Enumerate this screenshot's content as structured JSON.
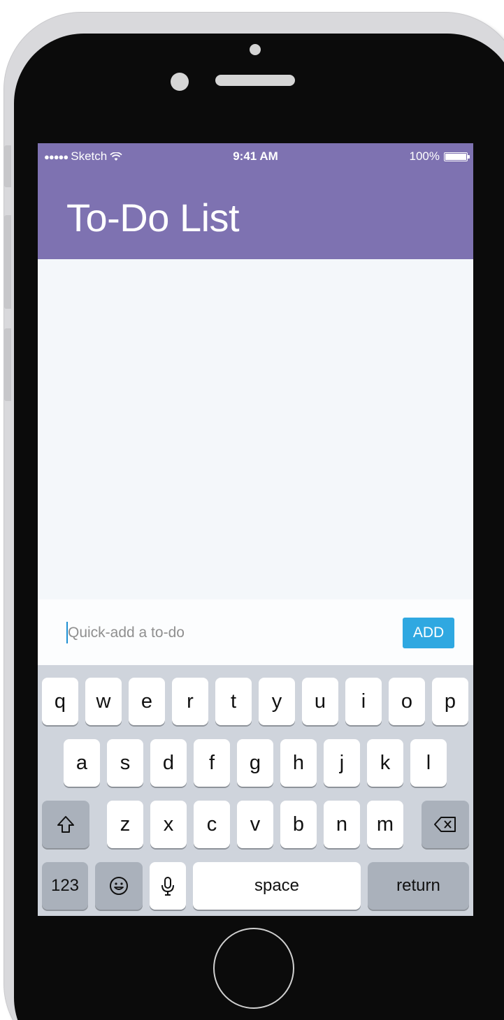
{
  "status_bar": {
    "carrier": "Sketch",
    "time": "9:41 AM",
    "battery": "100%"
  },
  "header": {
    "title": "To-Do List"
  },
  "todos": [],
  "quick_add": {
    "placeholder": "Quick-add a to-do",
    "value": "",
    "add_label": "ADD"
  },
  "keyboard": {
    "row1": [
      "q",
      "w",
      "e",
      "r",
      "t",
      "y",
      "u",
      "i",
      "o",
      "p"
    ],
    "row2": [
      "a",
      "s",
      "d",
      "f",
      "g",
      "h",
      "j",
      "k",
      "l"
    ],
    "row3": [
      "z",
      "x",
      "c",
      "v",
      "b",
      "n",
      "m"
    ],
    "numbers_label": "123",
    "space_label": "space",
    "return_label": "return"
  },
  "colors": {
    "header": "#7e72b1",
    "add_button": "#2fa8e1",
    "content_bg": "#f4f7fa",
    "keyboard_bg": "#cfd4dc"
  },
  "icons": {
    "signal": "signal-dots-icon",
    "wifi": "wifi-icon",
    "battery": "battery-icon",
    "shift": "shift-icon",
    "delete": "backspace-icon",
    "emoji": "emoji-icon",
    "mic": "microphone-icon"
  }
}
